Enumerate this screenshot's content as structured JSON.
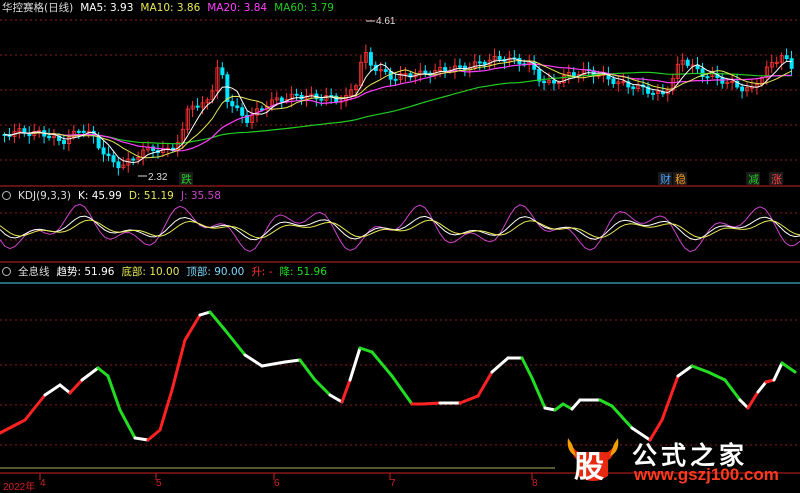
{
  "price_panel": {
    "title": "华控赛格(日线)",
    "ma5": "MA5: 3.93",
    "ma10": "MA10: 3.86",
    "ma20": "MA20: 3.84",
    "ma60": "MA60: 3.79",
    "high_label": "4.61",
    "low_label": "2.32",
    "markers": [
      {
        "text": "跌",
        "color": "#22cc22"
      },
      {
        "text": "财",
        "color": "#4aa0ff"
      },
      {
        "text": "稳",
        "color": "#ff9a1a"
      },
      {
        "text": "减",
        "color": "#22cc22"
      },
      {
        "text": "涨",
        "color": "#ff4444"
      }
    ]
  },
  "kdj_panel": {
    "title": "KDJ(9,3,3)",
    "k": "K: 45.99",
    "d": "D: 51.19",
    "j": "J: 35.58"
  },
  "qxx_panel": {
    "title": "全息线",
    "trend": "趋势: 51.96",
    "bottom": "底部: 10.00",
    "top": "顶部: 90.00",
    "up": "升: -",
    "down": "降: 51.96"
  },
  "x_axis": {
    "year": "2022年",
    "months": [
      "4",
      "5",
      "6",
      "7",
      "8"
    ]
  },
  "watermark": {
    "char": "股",
    "name": "公式之家",
    "url": "www.gszj100.com"
  },
  "colors": {
    "ma5": "#ffffff",
    "ma10": "#e8e855",
    "ma20": "#ff40ff",
    "ma60": "#22cc22",
    "up": "#ff3333",
    "down": "#00e5ff",
    "kdj_j": "#cc44cc",
    "qxx_up": "#ff2222",
    "qxx_down": "#22dd22",
    "qxx_turn": "#ffffff",
    "grid": "#8a1a1a",
    "axis": "#cc2222"
  }
}
